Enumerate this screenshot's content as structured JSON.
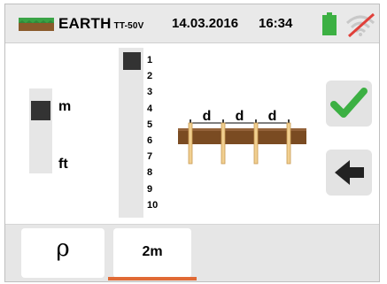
{
  "header": {
    "title": "EARTH",
    "subtitle": "TT-50V",
    "date": "14.03.2016",
    "time": "16:34",
    "icons": [
      "earth-ground-icon",
      "battery-icon",
      "wifi-off-icon"
    ],
    "battery_color": "#3cb043"
  },
  "unit_selector": {
    "options": [
      "m",
      "ft"
    ],
    "selected": "m"
  },
  "distance_selector": {
    "values": [
      "1",
      "2",
      "3",
      "4",
      "5",
      "6",
      "7",
      "8",
      "9",
      "10"
    ],
    "selected": "1"
  },
  "diagram": {
    "labels": [
      "d",
      "d",
      "d"
    ]
  },
  "buttons": {
    "confirm_icon": "checkmark-icon",
    "back_icon": "arrow-left-icon",
    "confirm_color": "#3cb043"
  },
  "tabs": [
    {
      "label": "ρ"
    },
    {
      "label": "2m",
      "active": true
    }
  ],
  "accent_color": "#e06a35"
}
